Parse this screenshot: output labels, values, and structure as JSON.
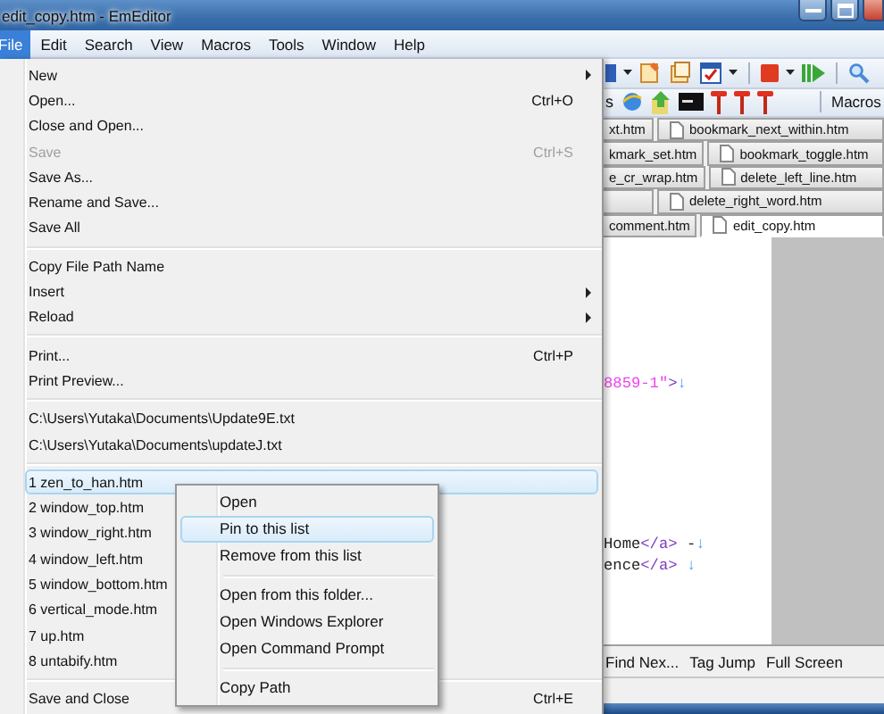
{
  "window": {
    "title": "edit_copy.htm - EmEditor"
  },
  "menu_bar": [
    {
      "label": "File",
      "selected": true
    },
    {
      "label": "Edit",
      "selected": false
    },
    {
      "label": "Search",
      "selected": false
    },
    {
      "label": "View",
      "selected": false
    },
    {
      "label": "Macros",
      "selected": false
    },
    {
      "label": "Tools",
      "selected": false
    },
    {
      "label": "Window",
      "selected": false
    },
    {
      "label": "Help",
      "selected": false
    }
  ],
  "file_menu": {
    "items": [
      {
        "kind": "item",
        "label": "New",
        "submenu": true,
        "disabled": false,
        "selected": false
      },
      {
        "kind": "item",
        "label": "Open...",
        "shortcut": "Ctrl+O",
        "disabled": false,
        "selected": false
      },
      {
        "kind": "item",
        "label": "Close and Open...",
        "disabled": false,
        "selected": false
      },
      {
        "kind": "item",
        "label": "Save",
        "shortcut": "Ctrl+S",
        "disabled": true,
        "selected": false
      },
      {
        "kind": "item",
        "label": "Save As...",
        "disabled": false,
        "selected": false
      },
      {
        "kind": "item",
        "label": "Rename and Save...",
        "disabled": false,
        "selected": false
      },
      {
        "kind": "item",
        "label": "Save All",
        "disabled": false,
        "selected": false
      },
      {
        "kind": "separator"
      },
      {
        "kind": "item",
        "label": "Copy File Path Name",
        "disabled": false,
        "selected": false
      },
      {
        "kind": "item",
        "label": "Insert",
        "submenu": true,
        "disabled": false,
        "selected": false
      },
      {
        "kind": "item",
        "label": "Reload",
        "submenu": true,
        "disabled": false,
        "selected": false
      },
      {
        "kind": "separator"
      },
      {
        "kind": "item",
        "label": "Print...",
        "shortcut": "Ctrl+P",
        "disabled": false,
        "selected": false
      },
      {
        "kind": "item",
        "label": "Print Preview...",
        "disabled": false,
        "selected": false
      },
      {
        "kind": "separator"
      },
      {
        "kind": "item",
        "label": "C:\\Users\\Yutaka\\Documents\\Update9E.txt",
        "disabled": false,
        "selected": false
      },
      {
        "kind": "item",
        "label": "C:\\Users\\Yutaka\\Documents\\updateJ.txt",
        "disabled": false,
        "selected": false
      },
      {
        "kind": "separator"
      },
      {
        "kind": "item",
        "label": "1 zen_to_han.htm",
        "disabled": false,
        "selected": true
      },
      {
        "kind": "item",
        "label": "2 window_top.htm",
        "disabled": false,
        "selected": false
      },
      {
        "kind": "item",
        "label": "3 window_right.htm",
        "disabled": false,
        "selected": false
      },
      {
        "kind": "item",
        "label": "4 window_left.htm",
        "disabled": false,
        "selected": false
      },
      {
        "kind": "item",
        "label": "5 window_bottom.htm",
        "disabled": false,
        "selected": false
      },
      {
        "kind": "item",
        "label": "6 vertical_mode.htm",
        "disabled": false,
        "selected": false
      },
      {
        "kind": "item",
        "label": "7 up.htm",
        "disabled": false,
        "selected": false
      },
      {
        "kind": "item",
        "label": "8 untabify.htm",
        "disabled": false,
        "selected": false
      },
      {
        "kind": "separator"
      },
      {
        "kind": "item",
        "label": "Save and Close",
        "shortcut": "Ctrl+E",
        "disabled": false,
        "selected": false
      }
    ]
  },
  "context_menu": {
    "items": [
      {
        "kind": "item",
        "label": "Open",
        "selected": false
      },
      {
        "kind": "item",
        "label": "Pin to this list",
        "selected": true
      },
      {
        "kind": "item",
        "label": "Remove from this list",
        "selected": false
      },
      {
        "kind": "separator"
      },
      {
        "kind": "item",
        "label": "Open from this folder...",
        "selected": false
      },
      {
        "kind": "item",
        "label": "Open Windows Explorer",
        "selected": false
      },
      {
        "kind": "item",
        "label": "Open Command Prompt",
        "selected": false
      },
      {
        "kind": "separator"
      },
      {
        "kind": "item",
        "label": "Copy Path",
        "selected": false
      }
    ]
  },
  "toolbar_2": {
    "cut_text": "s",
    "label": "Macros"
  },
  "tab_rows": [
    {
      "tabs": [
        {
          "label": "xt.htm",
          "selected": false
        },
        {
          "label": "bookmark_next_within.htm",
          "selected": false
        }
      ]
    },
    {
      "tabs": [
        {
          "label": "kmark_set.htm",
          "selected": false
        },
        {
          "label": "bookmark_toggle.htm",
          "selected": false
        }
      ]
    },
    {
      "tabs": [
        {
          "label": "e_cr_wrap.htm",
          "selected": false
        },
        {
          "label": "delete_left_line.htm",
          "selected": false
        }
      ]
    },
    {
      "tabs": [
        {
          "selected": false
        },
        {
          "label": "delete_right_word.htm",
          "selected": false
        }
      ]
    },
    {
      "tabs": [
        {
          "label": "comment.htm",
          "selected": false
        },
        {
          "label": "edit_copy.htm",
          "selected": true
        }
      ]
    }
  ],
  "editor": {
    "lines": [
      {
        "segments": [
          {
            "text": "8859-1\"",
            "kind": "value"
          },
          {
            "text": ">",
            "kind": "tag"
          },
          {
            "text": "↓",
            "kind": "eol"
          }
        ]
      },
      {
        "segments": [
          {
            "text": "Home",
            "kind": "text"
          },
          {
            "text": "</a>",
            "kind": "tag"
          },
          {
            "text": " -",
            "kind": "text"
          },
          {
            "text": "↓",
            "kind": "eol"
          }
        ]
      },
      {
        "segments": [
          {
            "text": "ence",
            "kind": "text"
          },
          {
            "text": "</a> ",
            "kind": "tag"
          },
          {
            "text": "↓",
            "kind": "eol"
          }
        ]
      }
    ]
  },
  "status_bar": {
    "buttons": [
      "Find Nex...",
      "Tag Jump",
      "Full Screen"
    ]
  }
}
